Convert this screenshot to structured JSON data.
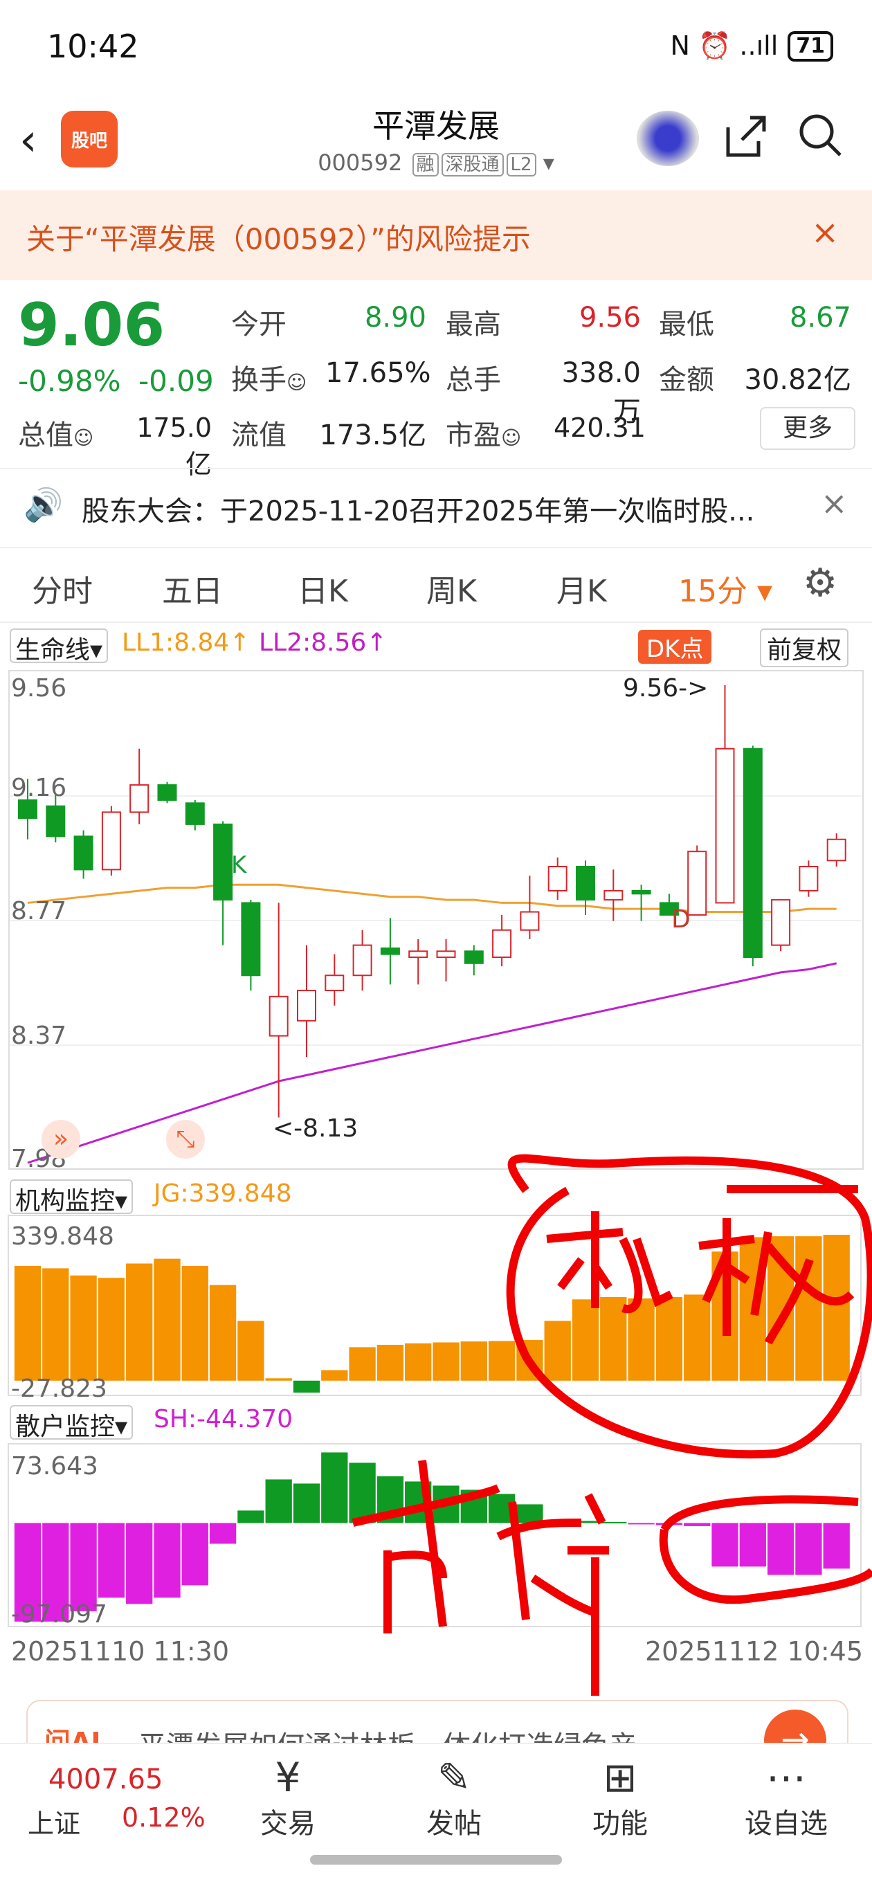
{
  "status": {
    "time": "10:42",
    "battery": "71",
    "signal_text": "N ⏰ ..ıll"
  },
  "header": {
    "back_icon": "‹",
    "logo": "股吧",
    "title": "平潭发展",
    "code": "000592",
    "tags": [
      "融",
      "深股通",
      "L2"
    ]
  },
  "risk": {
    "text": "关于“平潭发展（000592）”的风险提示",
    "close": "×"
  },
  "quote": {
    "price": "9.06",
    "change_pct": "-0.98%",
    "change_abs": "-0.09",
    "items": [
      {
        "label": "今开",
        "value": "8.90"
      },
      {
        "label": "最高",
        "value": "9.56"
      },
      {
        "label": "最低",
        "value": "8.67"
      },
      {
        "label": "换手",
        "value": "17.65%"
      },
      {
        "label": "总手",
        "value": "338.0万"
      },
      {
        "label": "金额",
        "value": "30.82亿"
      },
      {
        "label": "总值",
        "value": "175.0亿"
      },
      {
        "label": "流值",
        "value": "173.5亿"
      },
      {
        "label": "市盈",
        "value": "420.31"
      }
    ],
    "more": "更多"
  },
  "notice": {
    "text": "股东大会：于2025-11-20召开2025年第一次临时股...",
    "close": "×"
  },
  "tabs": [
    "分时",
    "五日",
    "日K",
    "周K",
    "月K",
    "15分 ▾"
  ],
  "indicator": {
    "selector": "生命线▾",
    "ll1": "LL1:8.84↑",
    "ll2": "LL2:8.56↑",
    "dk": "DK点",
    "fq": "前复权"
  },
  "chart_data": [
    {
      "type": "candlestick",
      "title": "",
      "y_ticks": [
        "9.56",
        "9.16",
        "8.77",
        "8.37",
        "7.98"
      ],
      "ylim": [
        7.98,
        9.56
      ],
      "annotations": [
        "9.56->",
        "<-8.13",
        "K",
        "D"
      ],
      "candles": [
        [
          9.18,
          9.12,
          9.25,
          9.05
        ],
        [
          9.16,
          9.06,
          9.2,
          9.04
        ],
        [
          9.06,
          8.95,
          9.08,
          8.92
        ],
        [
          8.95,
          9.14,
          9.16,
          8.93
        ],
        [
          9.14,
          9.23,
          9.35,
          9.1
        ],
        [
          9.23,
          9.18,
          9.24,
          9.17
        ],
        [
          9.17,
          9.1,
          9.18,
          9.08
        ],
        [
          9.1,
          8.85,
          9.11,
          8.7
        ],
        [
          8.84,
          8.6,
          8.85,
          8.55
        ],
        [
          8.4,
          8.53,
          8.84,
          8.13
        ],
        [
          8.45,
          8.55,
          8.7,
          8.33
        ],
        [
          8.55,
          8.6,
          8.67,
          8.5
        ],
        [
          8.6,
          8.7,
          8.75,
          8.55
        ],
        [
          8.69,
          8.67,
          8.79,
          8.57
        ],
        [
          8.66,
          8.68,
          8.72,
          8.57
        ],
        [
          8.66,
          8.68,
          8.72,
          8.58
        ],
        [
          8.68,
          8.64,
          8.7,
          8.6
        ],
        [
          8.66,
          8.75,
          8.8,
          8.63
        ],
        [
          8.75,
          8.81,
          8.93,
          8.72
        ],
        [
          8.88,
          8.96,
          8.99,
          8.85
        ],
        [
          8.96,
          8.85,
          8.98,
          8.8
        ],
        [
          8.85,
          8.88,
          8.95,
          8.78
        ],
        [
          8.88,
          8.87,
          8.9,
          8.78
        ],
        [
          8.84,
          8.8,
          8.87,
          8.8
        ],
        [
          8.8,
          9.01,
          9.03,
          8.8
        ],
        [
          8.84,
          9.35,
          9.56,
          8.84
        ],
        [
          9.35,
          8.66,
          9.36,
          8.63
        ],
        [
          8.7,
          8.85,
          8.85,
          8.68
        ],
        [
          8.88,
          8.96,
          8.98,
          8.86
        ],
        [
          8.98,
          9.05,
          9.07,
          8.96
        ]
      ],
      "ma_orange": [
        8.84,
        8.85,
        8.86,
        8.87,
        8.88,
        8.89,
        8.89,
        8.9,
        8.9,
        8.9,
        8.89,
        8.88,
        8.87,
        8.86,
        8.86,
        8.85,
        8.85,
        8.84,
        8.84,
        8.83,
        8.83,
        8.82,
        8.82,
        8.82,
        8.81,
        8.81,
        8.81,
        8.81,
        8.82,
        8.82
      ],
      "ma_purple": [
        7.98,
        8.01,
        8.04,
        8.07,
        8.1,
        8.13,
        8.16,
        8.19,
        8.22,
        8.25,
        8.27,
        8.29,
        8.31,
        8.33,
        8.35,
        8.37,
        8.39,
        8.41,
        8.43,
        8.45,
        8.47,
        8.49,
        8.51,
        8.53,
        8.55,
        8.57,
        8.59,
        8.61,
        8.62,
        8.64
      ]
    },
    {
      "type": "bar",
      "name_selector": "机构监控▾",
      "series_label": "JG:339.848",
      "y_ticks": [
        "339.848",
        "-27.823"
      ],
      "ylim": [
        -27.823,
        339.848
      ],
      "values": [
        240,
        235,
        220,
        215,
        245,
        255,
        240,
        200,
        125,
        5,
        -25,
        22,
        70,
        75,
        78,
        80,
        82,
        83,
        85,
        125,
        170,
        175,
        172,
        175,
        180,
        270,
        300,
        302,
        302,
        305
      ]
    },
    {
      "type": "bar",
      "name_selector": "散户监控▾",
      "series_label": "SH:-44.370",
      "y_ticks": [
        "73.643",
        "-97.097"
      ],
      "ylim": [
        -97.097,
        73.643
      ],
      "values": [
        -95,
        -95,
        -85,
        -72,
        -78,
        -72,
        -60,
        -20,
        12,
        42,
        38,
        68,
        58,
        45,
        40,
        36,
        32,
        28,
        18,
        3,
        2,
        1,
        -1,
        -2,
        -3,
        -42,
        -42,
        -50,
        -50,
        -44
      ]
    }
  ],
  "x_axis": {
    "start": "20251110 11:30",
    "end": "20251112 10:45"
  },
  "handwriting": [
    "机构",
    "散户"
  ],
  "ad": {
    "logo": "问AI",
    "text": "平潭发展如何通过林板一体化打造绿色产"
  },
  "index": {
    "value": "4007.65",
    "name": "上证",
    "pct": "0.12%"
  },
  "nav": [
    {
      "icon": "¥",
      "label": "交易"
    },
    {
      "icon": "✎",
      "label": "发帖"
    },
    {
      "icon": "⊞",
      "label": "功能"
    },
    {
      "icon": "⋯",
      "label": "设自选"
    }
  ],
  "colors": {
    "up": "#d8242a",
    "down": "#0f9a24",
    "accent": "#f07020",
    "orange_bar": "#f59300",
    "purple": "#e020e0",
    "pen": "#f00000"
  }
}
